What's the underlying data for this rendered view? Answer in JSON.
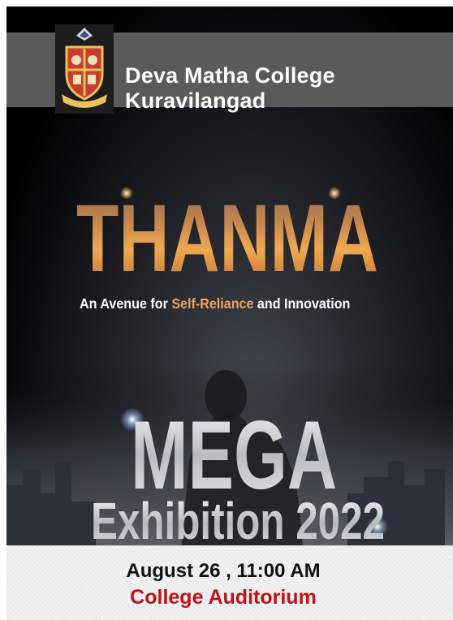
{
  "header": {
    "college_name": "Deva Matha College Kuravilangad",
    "logo_icon": "college-crest-icon"
  },
  "event": {
    "title": "THANMA",
    "tagline_part1": "An Avenue for ",
    "tagline_highlight": "Self-Reliance",
    "tagline_part2": " and Innovation",
    "headline": "MEGA",
    "subheadline": "Exhibition 2022"
  },
  "footer": {
    "date_time": "August 26 , 11:00 AM",
    "venue": "College Auditorium"
  },
  "colors": {
    "header_bar": "#5a5a5a",
    "highlight": "#f1a25c",
    "venue": "#c30f17",
    "title_gold": "#d9964f"
  }
}
